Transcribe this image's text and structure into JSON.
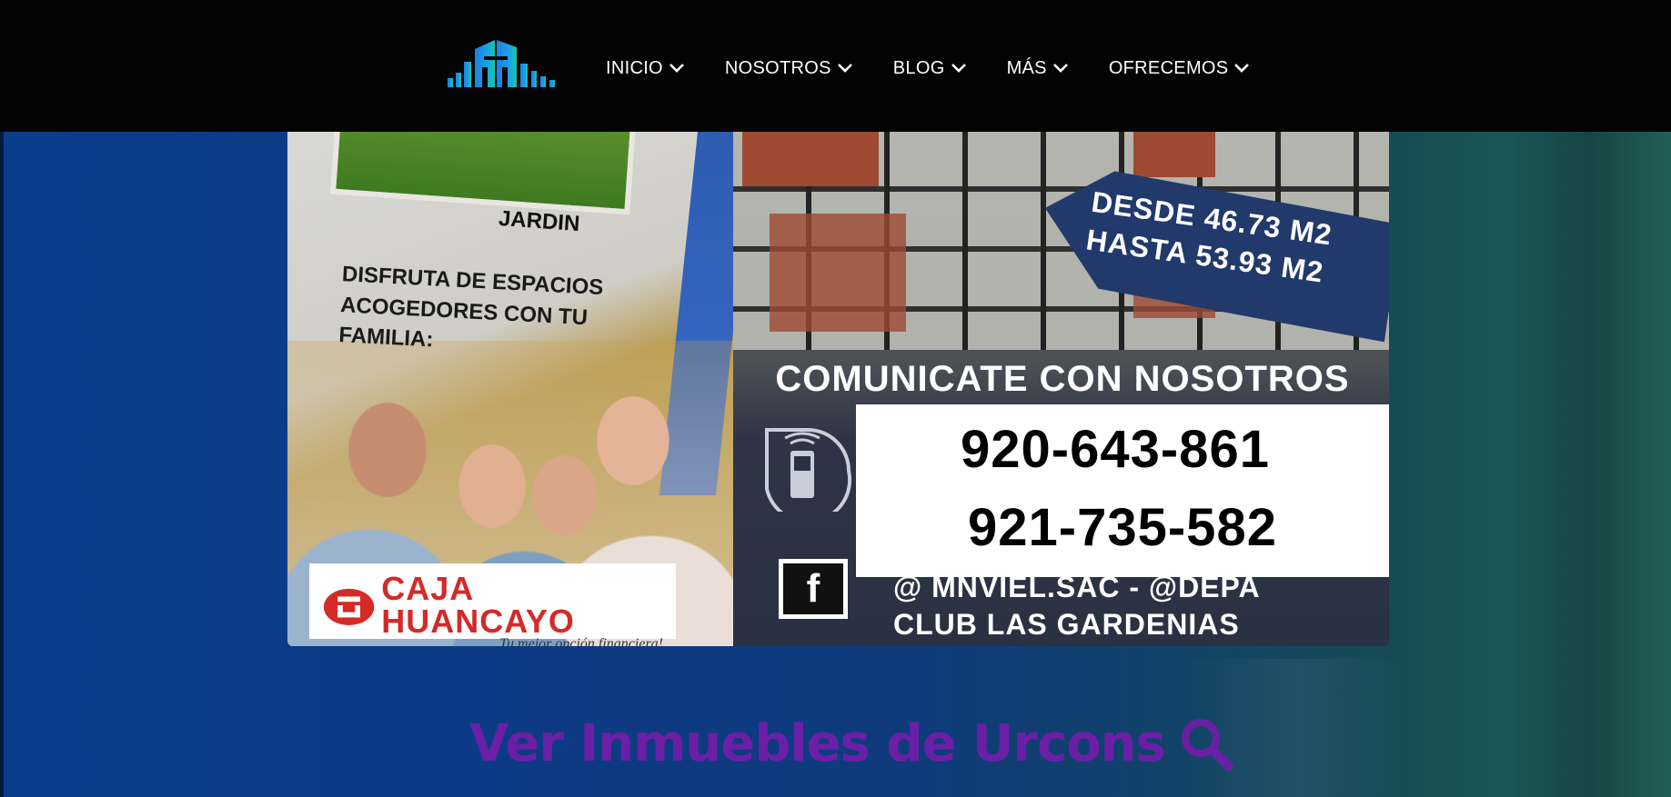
{
  "nav": {
    "logo_icon": "building-bars-logo",
    "items": [
      {
        "label": "INICIO",
        "icon": "chevron-down-icon"
      },
      {
        "label": "NOSOTROS",
        "icon": "chevron-down-icon"
      },
      {
        "label": "BLOG",
        "icon": "chevron-down-icon"
      },
      {
        "label": "MÁS",
        "icon": "chevron-down-icon"
      },
      {
        "label": "OFRECEMOS",
        "icon": "chevron-down-icon"
      }
    ]
  },
  "banner": {
    "garden_label": "JARDIN",
    "tagline": "DISFRUTA DE ESPACIOS ACOGEDORES CON TU FAMILIA:",
    "size_line1": "DESDE 46.73 M2",
    "size_line2": "HASTA 53.93 M2",
    "contact_heading": "COMUNICATE CON NOSOTROS",
    "phone1": "920-643-861",
    "phone2": "921-735-582",
    "social_line1": "@ MNVIEL.SAC -  @DEPA",
    "social_line2": "CLUB LAS GARDENIAS",
    "bank_name": "CAJA HUANCAYO",
    "bank_tagline": "...Tu mejor opción financiera!"
  },
  "search": {
    "heading": "Ver Inmuebles de Urcons",
    "icon": "search-icon"
  },
  "colors": {
    "nav_bg": "#030304",
    "heading_purple": "#6a1fa6",
    "bank_red": "#d42a28",
    "hero_blue": "#0a3d8c"
  }
}
